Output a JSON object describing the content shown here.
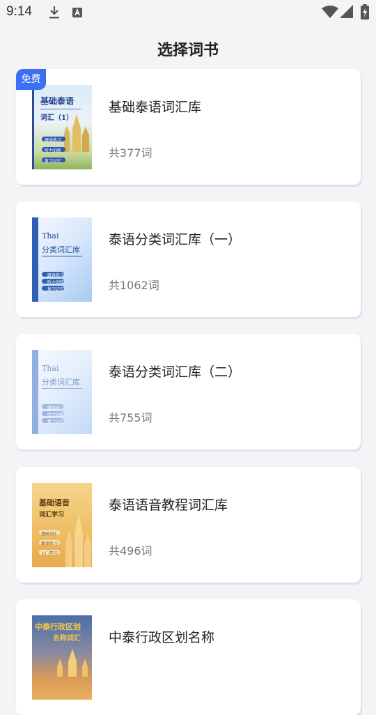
{
  "status": {
    "time": "9:14"
  },
  "header": {
    "title": "选择词书"
  },
  "books": [
    {
      "title": "基础泰语词汇库",
      "count": "共377词",
      "badge": "免费",
      "cover": {
        "line1": "基础泰语",
        "line2": "词汇（1）",
        "items": [
          "跟读练习",
          "听力训练",
          "复习记忆"
        ]
      }
    },
    {
      "title": "泰语分类词汇库（一）",
      "count": "共1062词",
      "cover": {
        "line1": "Thai",
        "line2": "分类词汇库",
        "items": [
          "跟读练习",
          "听力训练",
          "复习记忆"
        ]
      }
    },
    {
      "title": "泰语分类词汇库（二）",
      "count": "共755词",
      "cover": {
        "line1": "Thai",
        "line2": "分类词汇库",
        "items": [
          "跟读练习",
          "听力训练",
          "复习记忆"
        ]
      }
    },
    {
      "title": "泰语语音教程词汇库",
      "count": "共496词",
      "cover": {
        "line1": "基础语音",
        "line2": "词汇学习",
        "items": [
          "基础词汇",
          "跟读练习",
          "入门学习"
        ]
      }
    },
    {
      "title": "中泰行政区划名称",
      "cover": {
        "line1": "中泰行政区划",
        "line2": "名称词汇"
      }
    }
  ],
  "colors": {
    "badge": "#3b6ff4",
    "accent": "#3e6bc4"
  }
}
